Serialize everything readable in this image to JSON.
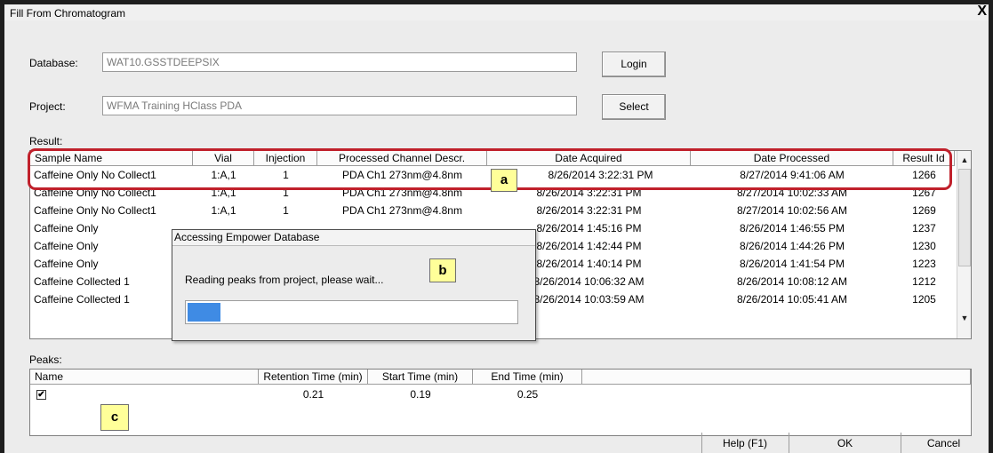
{
  "window": {
    "title": "Fill From Chromatogram",
    "close_glyph": "X"
  },
  "database": {
    "label": "Database:",
    "value": "WAT10.GSSTDEEPSIX",
    "button": "Login"
  },
  "project": {
    "label": "Project:",
    "value": "WFMA Training HClass PDA",
    "button": "Select"
  },
  "result": {
    "label": "Result:",
    "columns": [
      "Sample Name",
      "Vial",
      "Injection",
      "Processed Channel Descr.",
      "Date Acquired",
      "Date Processed",
      "Result Id"
    ],
    "rows": [
      [
        "Caffeine Only No Collect1",
        "1:A,1",
        "1",
        "PDA Ch1 273nm@4.8nm",
        "8/26/2014 3:22:31 PM",
        "8/27/2014 9:41:06 AM",
        "1266"
      ],
      [
        "Caffeine Only No Collect1",
        "1:A,1",
        "1",
        "PDA Ch1 273nm@4.8nm",
        "8/26/2014 3:22:31 PM",
        "8/27/2014 10:02:33 AM",
        "1267"
      ],
      [
        "Caffeine Only No Collect1",
        "1:A,1",
        "1",
        "PDA Ch1 273nm@4.8nm",
        "8/26/2014 3:22:31 PM",
        "8/27/2014 10:02:56 AM",
        "1269"
      ],
      [
        "Caffeine Only",
        "",
        "",
        "",
        "8/26/2014 1:45:16 PM",
        "8/26/2014 1:46:55 PM",
        "1237"
      ],
      [
        "Caffeine Only",
        "",
        "",
        "",
        "8/26/2014 1:42:44 PM",
        "8/26/2014 1:44:26 PM",
        "1230"
      ],
      [
        "Caffeine Only",
        "",
        "",
        "",
        "8/26/2014 1:40:14 PM",
        "8/26/2014 1:41:54 PM",
        "1223"
      ],
      [
        "Caffeine Collected 1",
        "",
        "",
        "",
        "8/26/2014 10:06:32 AM",
        "8/26/2014 10:08:12 AM",
        "1212"
      ],
      [
        "Caffeine Collected 1",
        "",
        "",
        "",
        "8/26/2014 10:03:59 AM",
        "8/26/2014 10:05:41 AM",
        "1205"
      ]
    ]
  },
  "callouts": {
    "a": "a",
    "b": "b",
    "c": "c"
  },
  "progress_dialog": {
    "title": "Accessing Empower Database",
    "message": "Reading peaks from project, please wait...",
    "progress": 0.1
  },
  "peaks": {
    "label": "Peaks:",
    "columns": [
      "Name",
      "Retention Time (min)",
      "Start Time (min)",
      "End Time (min)"
    ],
    "rows": [
      {
        "checked": true,
        "check_glyph": "✔",
        "retention": "0.21",
        "start": "0.19",
        "end": "0.25"
      }
    ]
  },
  "buttons": {
    "help": "Help (F1)",
    "ok": "OK",
    "cancel": "Cancel"
  },
  "colors": {
    "highlight_border": "#c0202b",
    "callout_fill": "#ffff99",
    "progress_fill": "#3f8be4"
  }
}
